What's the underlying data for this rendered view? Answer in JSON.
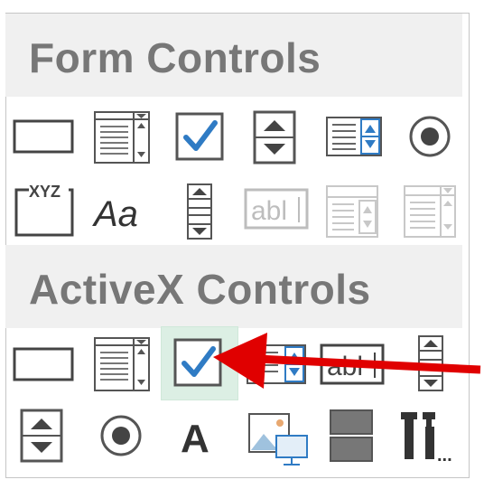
{
  "sections": {
    "form_controls_title": "Form Controls",
    "activex_controls_title": "ActiveX Controls"
  },
  "colors": {
    "header_bg": "#f0f0f0",
    "header_text": "#777777",
    "icon_dark": "#444444",
    "icon_disabled": "#bdbdbd",
    "check_blue": "#2f7bc4",
    "arrow_red": "#e00000",
    "highlight": "#dcefe4"
  },
  "form_controls": [
    "button-icon",
    "combo-box-icon",
    "check-box-icon",
    "spin-button-icon",
    "list-box-icon",
    "option-button-icon",
    "group-box-icon",
    "label-icon",
    "scroll-bar-icon",
    "text-field-icon",
    "combo-list-edit-icon",
    "combo-drop-down-edit-icon"
  ],
  "activex_controls": [
    "command-button-icon",
    "combo-box-icon",
    "check-box-icon",
    "list-box-icon",
    "text-box-icon",
    "scroll-bar-icon",
    "spin-button-icon",
    "option-button-icon",
    "label-icon",
    "image-icon",
    "toggle-button-icon",
    "more-controls-icon"
  ],
  "text": {
    "xyz": "XYZ",
    "aa": "Aa",
    "abl": "abl",
    "a": "A",
    "more": "..."
  }
}
